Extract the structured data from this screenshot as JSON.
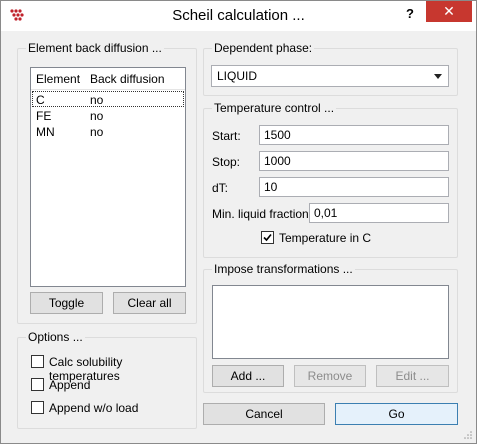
{
  "window": {
    "title": "Scheil calculation ...",
    "help": "?",
    "close": "✕"
  },
  "element_diffusion": {
    "label": "Element back diffusion ...",
    "headers": [
      "Element",
      "Back diffusion"
    ],
    "rows": [
      {
        "element": "C",
        "diffusion": "no"
      },
      {
        "element": "FE",
        "diffusion": "no"
      },
      {
        "element": "MN",
        "diffusion": "no"
      }
    ],
    "toggle": "Toggle",
    "clear_all": "Clear all"
  },
  "options": {
    "label": "Options ...",
    "calc_solubility": "Calc solubility temperatures",
    "append": "Append",
    "append_wo_load": "Append w/o load"
  },
  "dependent_phase": {
    "label": "Dependent phase:",
    "value": "LIQUID"
  },
  "temperature": {
    "label": "Temperature control ...",
    "start_label": "Start:",
    "start": "1500",
    "stop_label": "Stop:",
    "stop": "1000",
    "dt_label": "dT:",
    "dt": "10",
    "min_liquid_label": "Min. liquid fraction:",
    "min_liquid": "0,01",
    "in_c_label": "Temperature in C",
    "in_c_checked": true
  },
  "transformations": {
    "label": "Impose transformations ...",
    "add": "Add ...",
    "remove": "Remove",
    "edit": "Edit ..."
  },
  "footer": {
    "cancel": "Cancel",
    "go": "Go"
  }
}
